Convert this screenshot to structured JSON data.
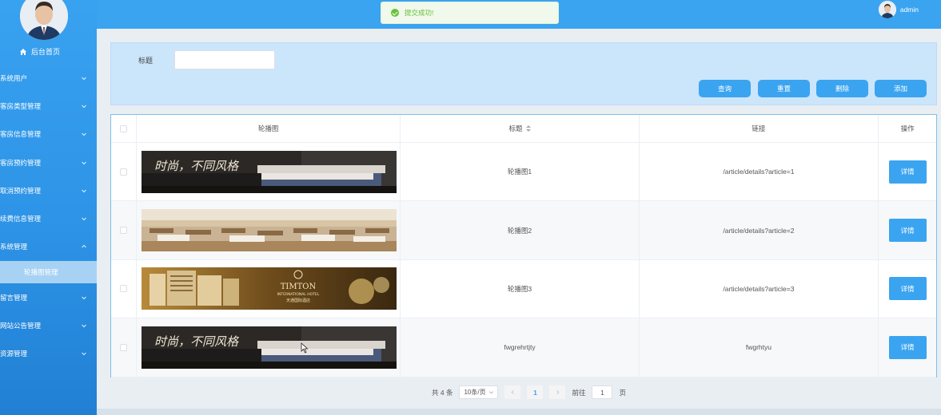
{
  "sidebar": {
    "home_label": "后台首页",
    "menu": [
      {
        "label": "系统用户",
        "expanded": false
      },
      {
        "label": "客房类型管理",
        "expanded": false
      },
      {
        "label": "客房信息管理",
        "expanded": false
      },
      {
        "label": "客房预约管理",
        "expanded": false
      },
      {
        "label": "取消预约管理",
        "expanded": false
      },
      {
        "label": "续费信息管理",
        "expanded": false
      },
      {
        "label": "系统管理",
        "expanded": true
      }
    ],
    "submenu_active": "轮播图管理",
    "menu_after": [
      {
        "label": "留言管理"
      },
      {
        "label": "网站公告管理"
      },
      {
        "label": "资源管理"
      }
    ]
  },
  "header": {
    "toast": "提交成功!",
    "username": "admin"
  },
  "search": {
    "label": "标题",
    "value": "",
    "buttons": {
      "query": "查询",
      "reset": "重置",
      "delete": "删除",
      "add": "添加"
    }
  },
  "table": {
    "columns": {
      "image": "轮播图",
      "title": "标题",
      "link": "链接",
      "actions": "操作"
    },
    "rows": [
      {
        "title": "轮播图1",
        "link": "/article/details?article=1",
        "action": "详情",
        "image": "banner-bedroom"
      },
      {
        "title": "轮播图2",
        "link": "/article/details?article=2",
        "action": "详情",
        "image": "banner-restaurant"
      },
      {
        "title": "轮播图3",
        "link": "/article/details?article=3",
        "action": "详情",
        "image": "banner-hotel"
      },
      {
        "title": "fwgrehrtjty",
        "link": "fwgrhtyu",
        "action": "详情",
        "image": "banner-bedroom"
      }
    ]
  },
  "pagination": {
    "total": "共 4 条",
    "page_size": "10条/页",
    "current_page": "1",
    "goto_label": "前往",
    "goto_value": "1",
    "page_suffix": "页"
  },
  "banner_text": {
    "slogan": "时尚，不同风格",
    "hotel_name": "TIMTON",
    "hotel_sub": "INTERNATIONAL HOTEL",
    "hotel_cn": "天通国际酒店"
  },
  "colors": {
    "accent": "#3aa4f0",
    "success": "#67c23a"
  }
}
